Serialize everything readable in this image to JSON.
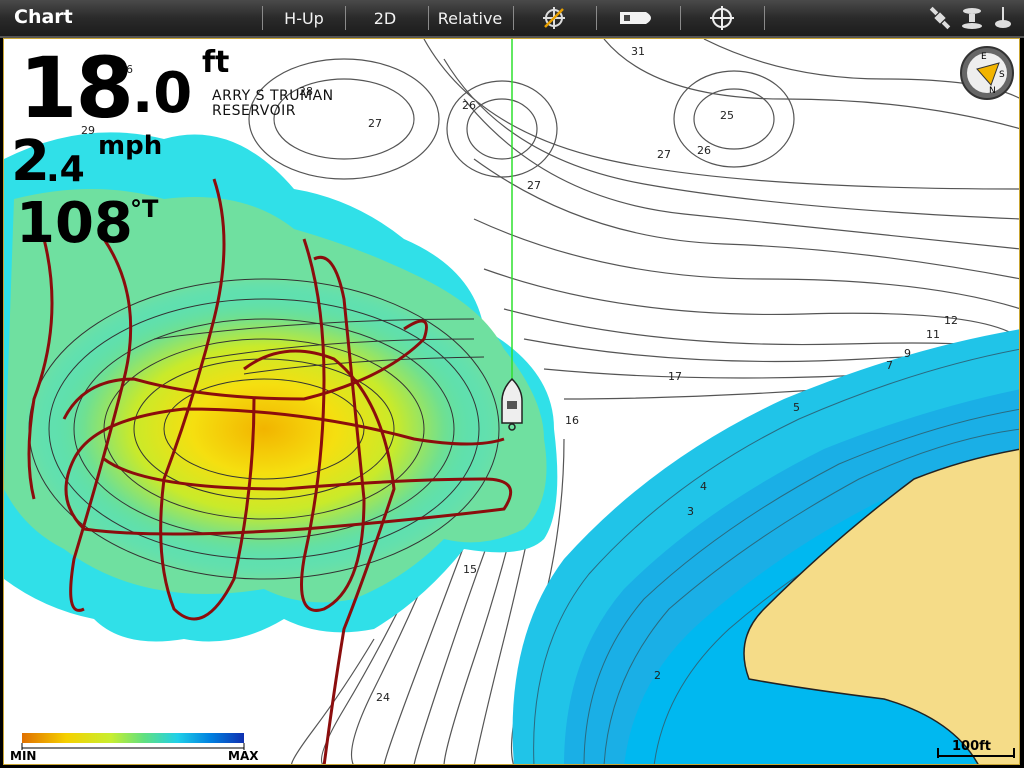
{
  "topbar": {
    "title": "Chart",
    "hup": "H-Up",
    "view": "2D",
    "motion": "Relative",
    "icons": [
      "no-target-icon",
      "boat-icon",
      "crosshair-icon",
      "satellite-icon",
      "sonar-icon",
      "transducer-icon"
    ]
  },
  "readouts": {
    "depth_int": "18",
    "depth_dec": ".0",
    "depth_unit": "ft",
    "speed_int": "2",
    "speed_dec": ".4",
    "speed_unit": "mph",
    "heading": "108",
    "heading_unit": "°T"
  },
  "place_name": {
    "line1": "ARRY S TRUMAN",
    "line2": "RESERVOIR"
  },
  "depth_labels": [
    "36",
    "28",
    "26",
    "27",
    "29",
    "31",
    "25",
    "27",
    "26",
    "27",
    "17",
    "16",
    "15",
    "12",
    "11",
    "9",
    "7",
    "5",
    "4",
    "3",
    "2",
    "24"
  ],
  "compass": {
    "letters": [
      "E",
      "S",
      "N"
    ]
  },
  "legend": {
    "min": "MIN",
    "max": "MAX"
  },
  "scale": {
    "label": "100ft"
  },
  "colors": {
    "frame": "#c9a532",
    "track": "#8b0d0d",
    "land": "#f5dc88",
    "shallow": "#00b8f0",
    "heading_line": "#2ee02e"
  }
}
